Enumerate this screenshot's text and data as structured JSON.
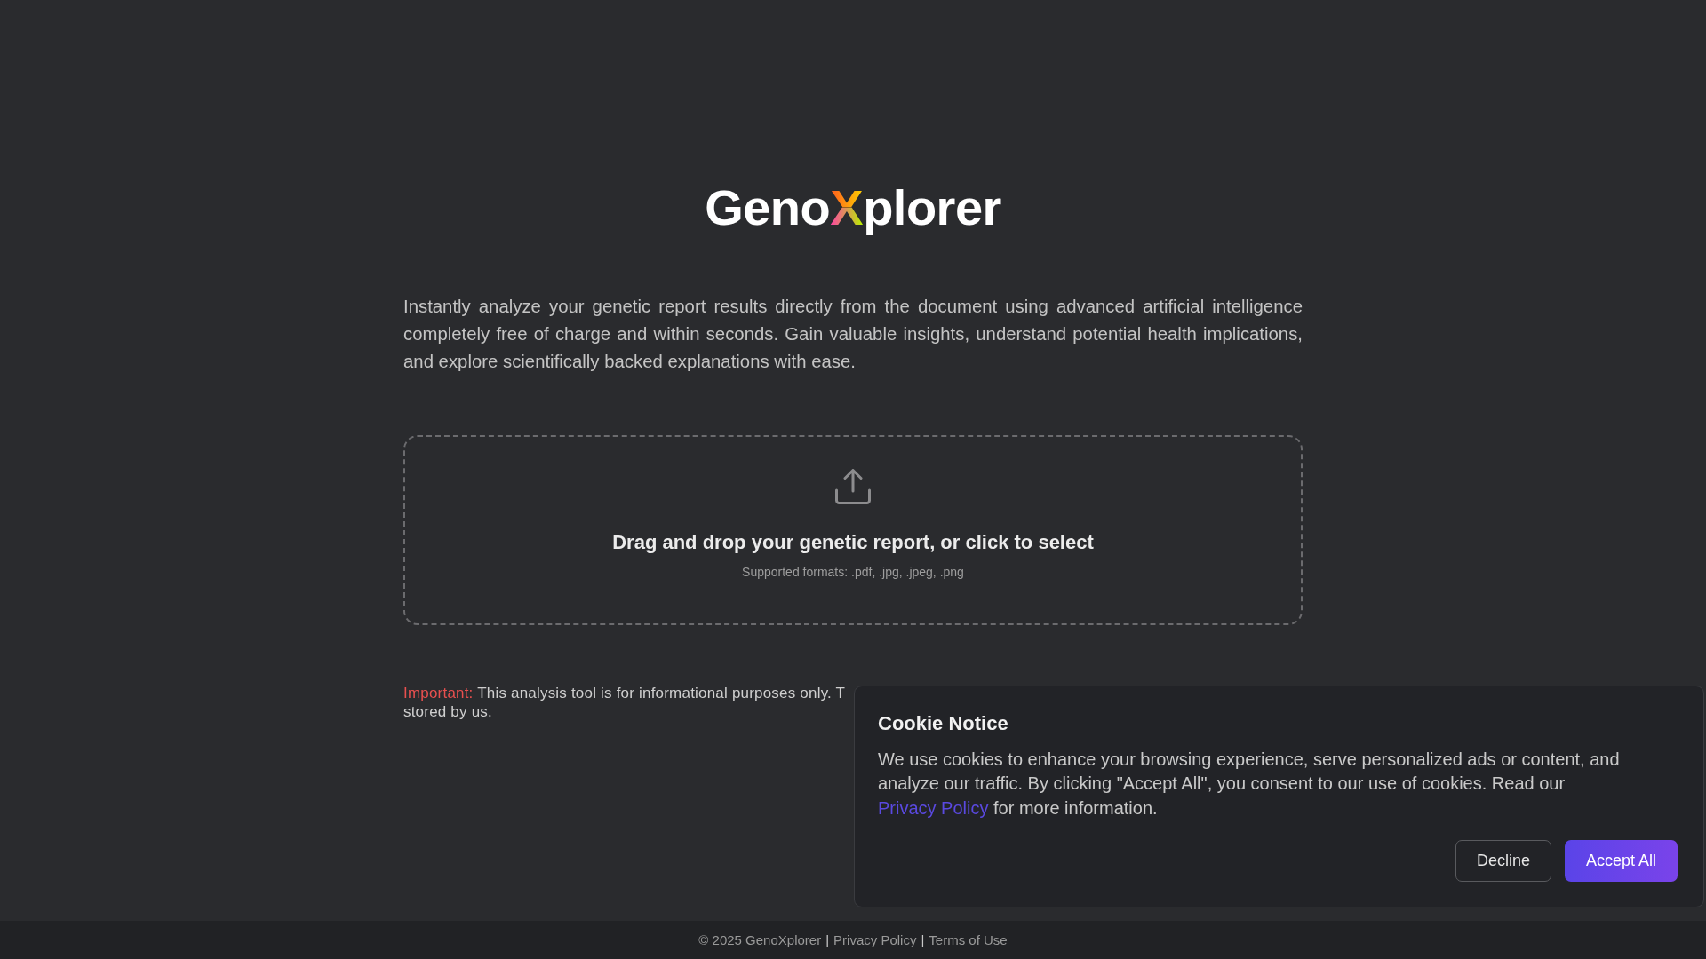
{
  "logo": {
    "prefix": "Geno",
    "accent": "X",
    "suffix": "plorer"
  },
  "description": "Instantly analyze your genetic report results directly from the document using advanced artificial intelligence completely free of charge and within seconds. Gain valuable insights, understand potential health implications, and explore scientifically backed explanations with ease.",
  "upload": {
    "prompt": "Drag and drop your genetic report, or click to select",
    "formats": "Supported formats: .pdf, .jpg, .jpeg, .png"
  },
  "notice": {
    "label": "Important:",
    "lines": [
      "This analysis tool is for informational purposes only. T",
      "stored by us."
    ]
  },
  "cookie_notice": {
    "title": "Cookie Notice",
    "text_before": "We use cookies to enhance your browsing experience, serve personalized ads or content, and analyze our traffic. By clicking \"Accept All\", you consent to our use of cookies. Read our",
    "link": "Privacy Policy",
    "text_after": "for more information.",
    "buttons": [
      {
        "label": "Decline",
        "kind": "secondary"
      },
      {
        "label": "Accept All",
        "kind": "primary"
      }
    ]
  },
  "footer": {
    "items": [
      {
        "kind": "text",
        "text": "© 2025 GenoXplorer"
      },
      {
        "kind": "separator",
        "text": "|"
      },
      {
        "kind": "link",
        "text": "Privacy Policy"
      },
      {
        "kind": "separator",
        "text": "|"
      },
      {
        "kind": "link",
        "text": "Terms of Use"
      }
    ]
  }
}
